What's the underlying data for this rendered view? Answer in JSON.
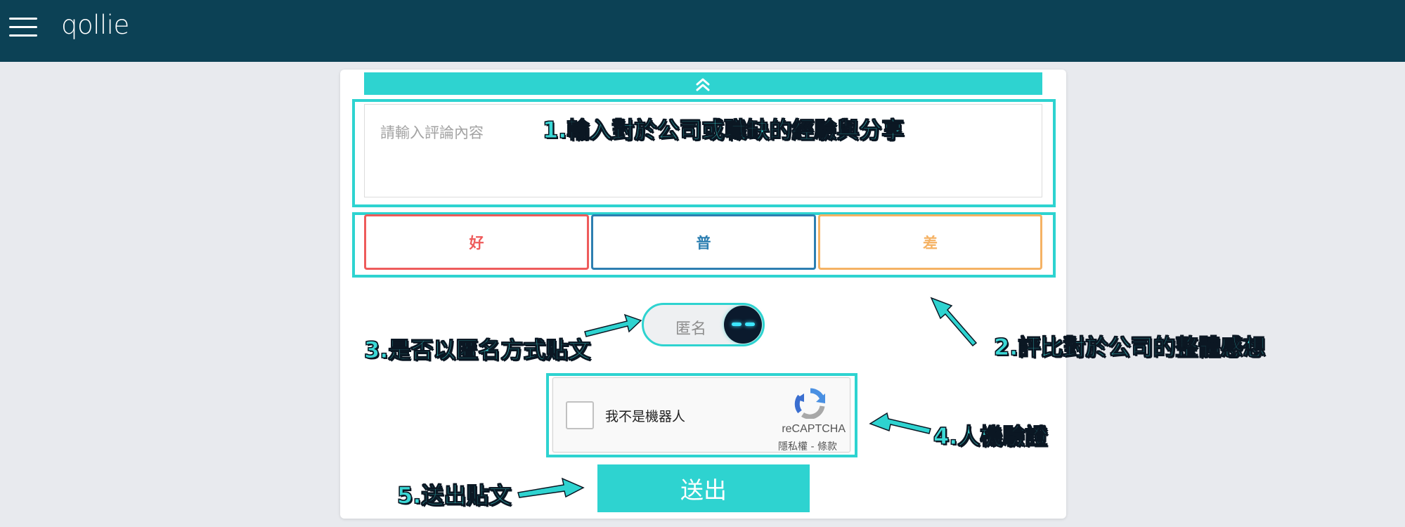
{
  "header": {
    "brand": "qollie",
    "menu_icon": "hamburger-icon"
  },
  "review_form": {
    "collapse_icon": "chevrons-up-icon",
    "comment_placeholder": "請輸入評論內容",
    "ratings": [
      {
        "label": "好",
        "color": "#ee5b5b"
      },
      {
        "label": "普",
        "color": "#2d7fb1"
      },
      {
        "label": "差",
        "color": "#f5b264"
      }
    ],
    "anonymous_label": "匿名",
    "captcha": {
      "label": "我不是機器人",
      "brand": "reCAPTCHA",
      "privacy": "隱私權",
      "separator": " - ",
      "terms": "條款"
    },
    "submit_label": "送出"
  },
  "annotations": {
    "step1": "1.輸入對於公司或職缺的經驗與分享",
    "step2": "2.評比對於公司的整體感想",
    "step3": "3.是否以匿名方式貼文",
    "step4": "4.人機驗證",
    "step5": "5.送出貼文"
  },
  "colors": {
    "nav_bg": "#0c4155",
    "accent": "#2ed3d0",
    "page_bg": "#e8eaee"
  }
}
